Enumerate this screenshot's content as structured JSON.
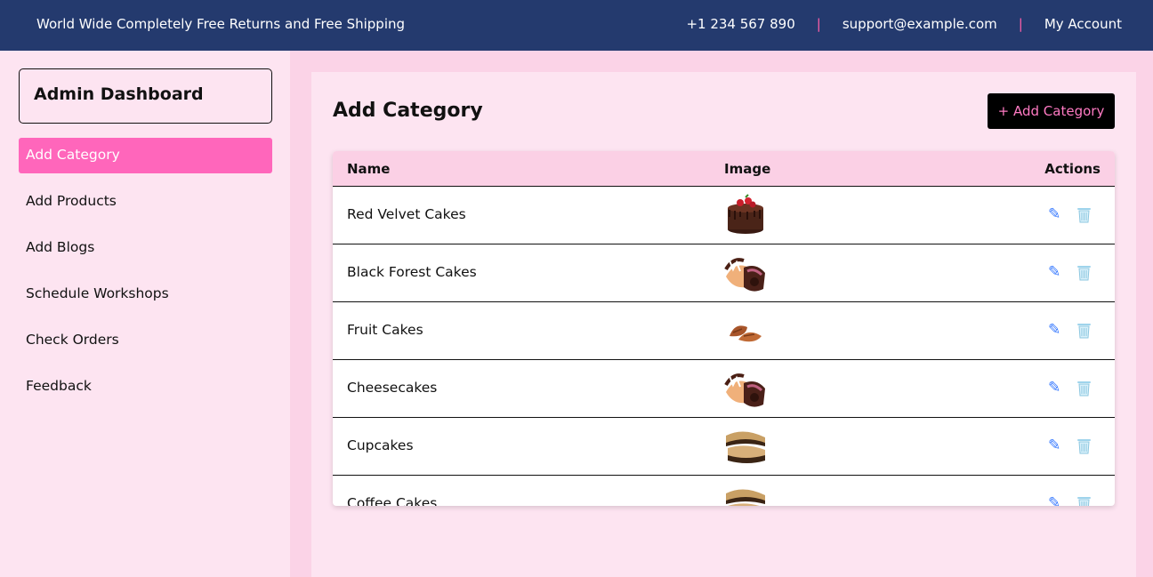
{
  "topbar": {
    "promo": "World Wide Completely Free Returns and Free Shipping",
    "phone": "+1 234 567 890",
    "separator": "|",
    "email": "support@example.com",
    "account": "My Account"
  },
  "sidebar": {
    "title": "Admin Dashboard",
    "items": [
      {
        "label": "Add Category",
        "active": true
      },
      {
        "label": "Add Products",
        "active": false
      },
      {
        "label": "Add Blogs",
        "active": false
      },
      {
        "label": "Schedule Workshops",
        "active": false
      },
      {
        "label": "Check Orders",
        "active": false
      },
      {
        "label": "Feedback",
        "active": false
      }
    ]
  },
  "main": {
    "title": "Add Category",
    "add_button": "+ Add Category",
    "table": {
      "headers": {
        "name": "Name",
        "image": "Image",
        "actions": "Actions"
      },
      "rows": [
        {
          "name": "Red Velvet Cakes",
          "image_icon": "chocolate-cake-image"
        },
        {
          "name": "Black Forest Cakes",
          "image_icon": "cake-slices-image"
        },
        {
          "name": "Fruit Cakes",
          "image_icon": "pastry-image"
        },
        {
          "name": "Cheesecakes",
          "image_icon": "cake-slices-image"
        },
        {
          "name": "Cupcakes",
          "image_icon": "layered-bars-image"
        },
        {
          "name": "Coffee Cakes",
          "image_icon": "layered-bars-image"
        }
      ],
      "edit_icon": "pencil-icon",
      "delete_icon": "trash-icon"
    }
  },
  "colors": {
    "topbar": "#243a6e",
    "accent": "#ff66bb",
    "page_bg": "#fbd3e7",
    "panel_bg": "#fde4f1"
  }
}
